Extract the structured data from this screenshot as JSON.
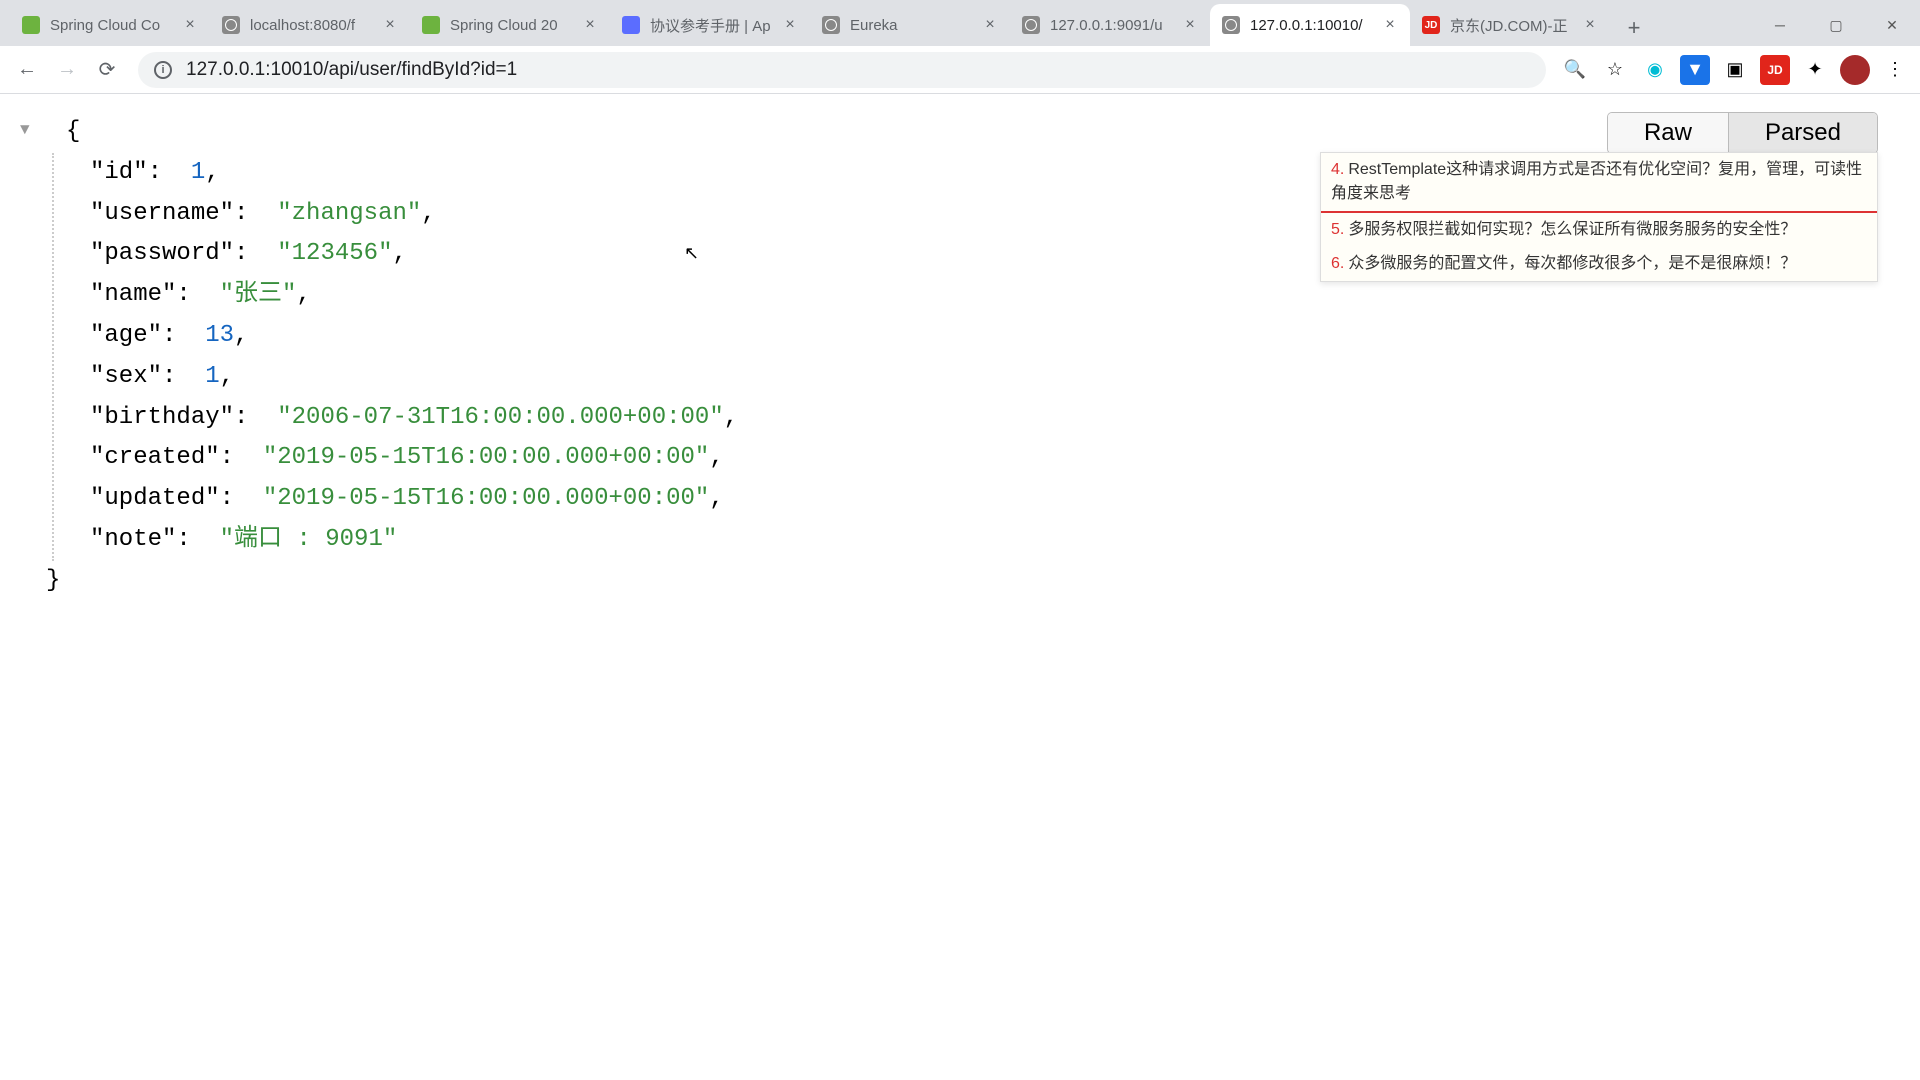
{
  "tabs": [
    {
      "label": "Spring Cloud Co",
      "favtype": "spring"
    },
    {
      "label": "localhost:8080/f",
      "favtype": "globe"
    },
    {
      "label": "Spring Cloud 20",
      "favtype": "spring"
    },
    {
      "label": "协议参考手册 | Ap",
      "favtype": "doc"
    },
    {
      "label": "Eureka",
      "favtype": "globe"
    },
    {
      "label": "127.0.0.1:9091/u",
      "favtype": "globe"
    },
    {
      "label": "127.0.0.1:10010/",
      "favtype": "globe",
      "active": true
    },
    {
      "label": "京东(JD.COM)-正",
      "favtype": "jd"
    }
  ],
  "url": "127.0.0.1:10010/api/user/findById?id=1",
  "view_toggle": {
    "raw": "Raw",
    "parsed": "Parsed"
  },
  "json": {
    "id_key": "\"id\"",
    "id_val": "1",
    "username_key": "\"username\"",
    "username_val": "\"zhangsan\"",
    "password_key": "\"password\"",
    "password_val": "\"123456\"",
    "name_key": "\"name\"",
    "name_val": "\"张三\"",
    "age_key": "\"age\"",
    "age_val": "13",
    "sex_key": "\"sex\"",
    "sex_val": "1",
    "birthday_key": "\"birthday\"",
    "birthday_val": "\"2006-07-31T16:00:00.000+00:00\"",
    "created_key": "\"created\"",
    "created_val": "\"2019-05-15T16:00:00.000+00:00\"",
    "updated_key": "\"updated\"",
    "updated_val": "\"2019-05-15T16:00:00.000+00:00\"",
    "note_key": "\"note\"",
    "note_val": "\"端口 : 9091\""
  },
  "notes": [
    {
      "n": "4.",
      "text": "RestTemplate这种请求调用方式是否还有优化空间？复用，管理，可读性角度来思考"
    },
    {
      "n": "5.",
      "text": "多服务权限拦截如何实现？怎么保证所有微服务服务的安全性？"
    },
    {
      "n": "6.",
      "text": "众多微服务的配置文件，每次都修改很多个，是不是很麻烦！？"
    }
  ]
}
